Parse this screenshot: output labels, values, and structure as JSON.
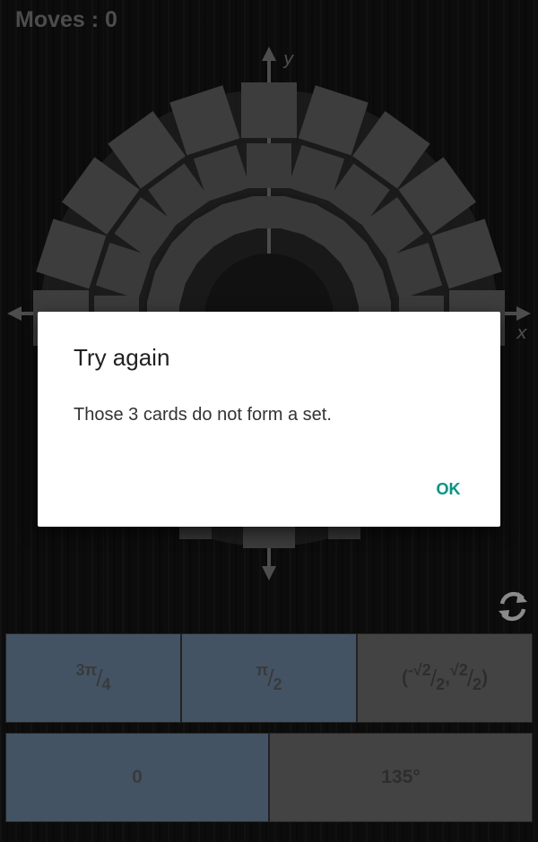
{
  "header": {
    "moves_label": "Moves : 0"
  },
  "board": {
    "x_axis_label": "x",
    "y_axis_label": "y"
  },
  "dialog": {
    "title": "Try again",
    "message": "Those 3 cards do not form a set.",
    "ok_label": "OK"
  },
  "cards": {
    "c1": {
      "num": "3π",
      "den": "4"
    },
    "c2": {
      "num": "π",
      "den": "2"
    },
    "c3": {
      "open": "(",
      "n1": "-√2",
      "d1": "2",
      "sep": ",",
      "n2": "√2",
      "d2": "2",
      "close": ")"
    },
    "c4": {
      "label": "0"
    },
    "c5": {
      "label": "135°"
    }
  },
  "colors": {
    "selected_card": "#435364",
    "card": "#434343",
    "accent": "#009688",
    "coordinate_text": "#8e1a1a"
  },
  "icons": {
    "refresh": "refresh-icon"
  }
}
